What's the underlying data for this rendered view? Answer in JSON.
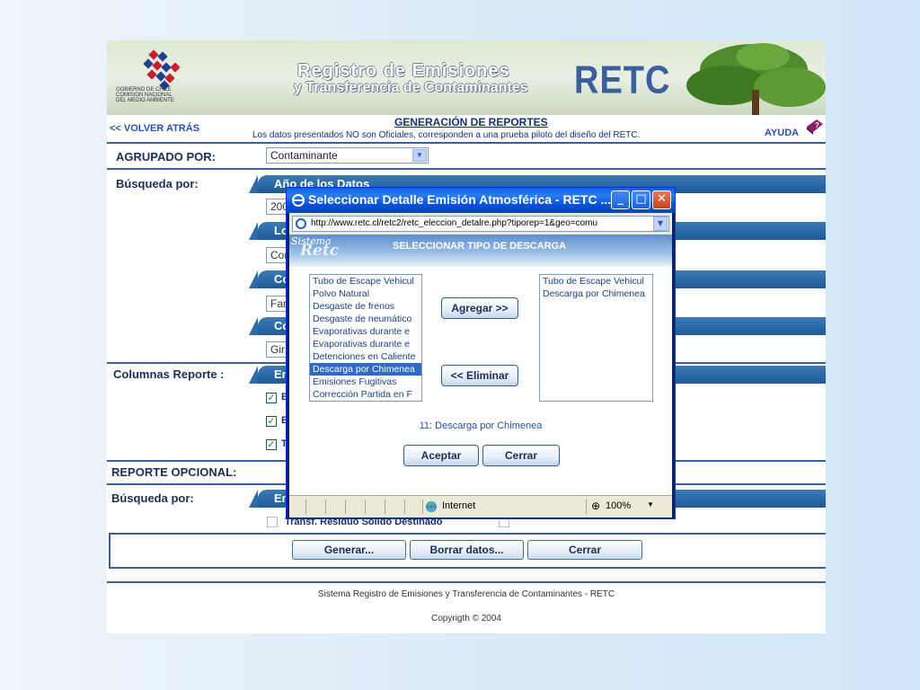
{
  "banner": {
    "gov_text": "GOBIERNO DE CHILE\nCOMISION NACIONAL\nDEL MEDIO AMBIENTE",
    "title_line1": "Registro de Emisiones",
    "title_line2": "y Transferencia de Contaminantes",
    "brand": "RETC"
  },
  "header": {
    "back_link": "<< VOLVER ATRÁS",
    "title": "GENERACIÓN DE REPORTES",
    "note": "Los datos presentados NO son Oficiales, corresponden a una prueba piloto del diseño del RETC.",
    "help": "AYUDA"
  },
  "form": {
    "agrupado_label": "AGRUPADO POR:",
    "agrupado_value": "Contaminante",
    "busqueda_label": "Búsqueda por:",
    "tabs": [
      {
        "label": "Año de los Datos",
        "value": "200"
      },
      {
        "label": "Loc",
        "value": "Cor"
      },
      {
        "label": "Cor",
        "value": "Far"
      },
      {
        "label": "Cód",
        "value": "Gir"
      }
    ],
    "columnas_label": "Columnas Reporte :",
    "columnas_tab": "Emis",
    "columnas_checks": [
      {
        "label": "E",
        "checked": true
      },
      {
        "label": "E",
        "checked": true
      },
      {
        "label": "T",
        "checked": true
      }
    ],
    "opcional_label": "REPORTE OPCIONAL:",
    "busqueda2_label": "Búsqueda por:",
    "busqueda2_tab": "Emis",
    "transf_label": "Transf. Residuo Sólido Destinado"
  },
  "actions": {
    "generar": "Generar...",
    "borrar": "Borrar datos...",
    "cerrar": "Cerrar"
  },
  "footer": {
    "line1": "Sistema Registro de Emisiones y Transferencia de Contaminantes - RETC",
    "line2": "Copyrigth © 2004"
  },
  "popup": {
    "title": "Seleccionar Detalle Emisión Atmosférica - RETC ...",
    "address": "http://www.retc.cl/retc2/retc_eleccion_detalre.php?tiporep=1&geo=comu",
    "logo_top": "Sistema",
    "logo_bottom": "Retc",
    "heading": "SELECCIONAR TIPO DE DESCARGA",
    "available": [
      "Tubo de Escape Vehicul",
      "Polvo Natural",
      "Desgaste de frenos",
      "Desgaste de neumático",
      "Evaporativas durante e",
      "Evaporativas durante e",
      "Detenciones en Caliente",
      "Descarga por Chimenea",
      "Emisiones Fugitivas",
      "Corrección Partida en F"
    ],
    "available_selected_index": 7,
    "selected": [
      "Tubo de Escape Vehicul",
      "Descarga por Chimenea"
    ],
    "add_button": "Agregar >>",
    "remove_button": "<< Eliminar",
    "selection_info": "11: Descarga por Chimenea",
    "accept_button": "Aceptar",
    "close_button": "Cerrar",
    "status_zone": "Internet",
    "zoom": "100%"
  }
}
